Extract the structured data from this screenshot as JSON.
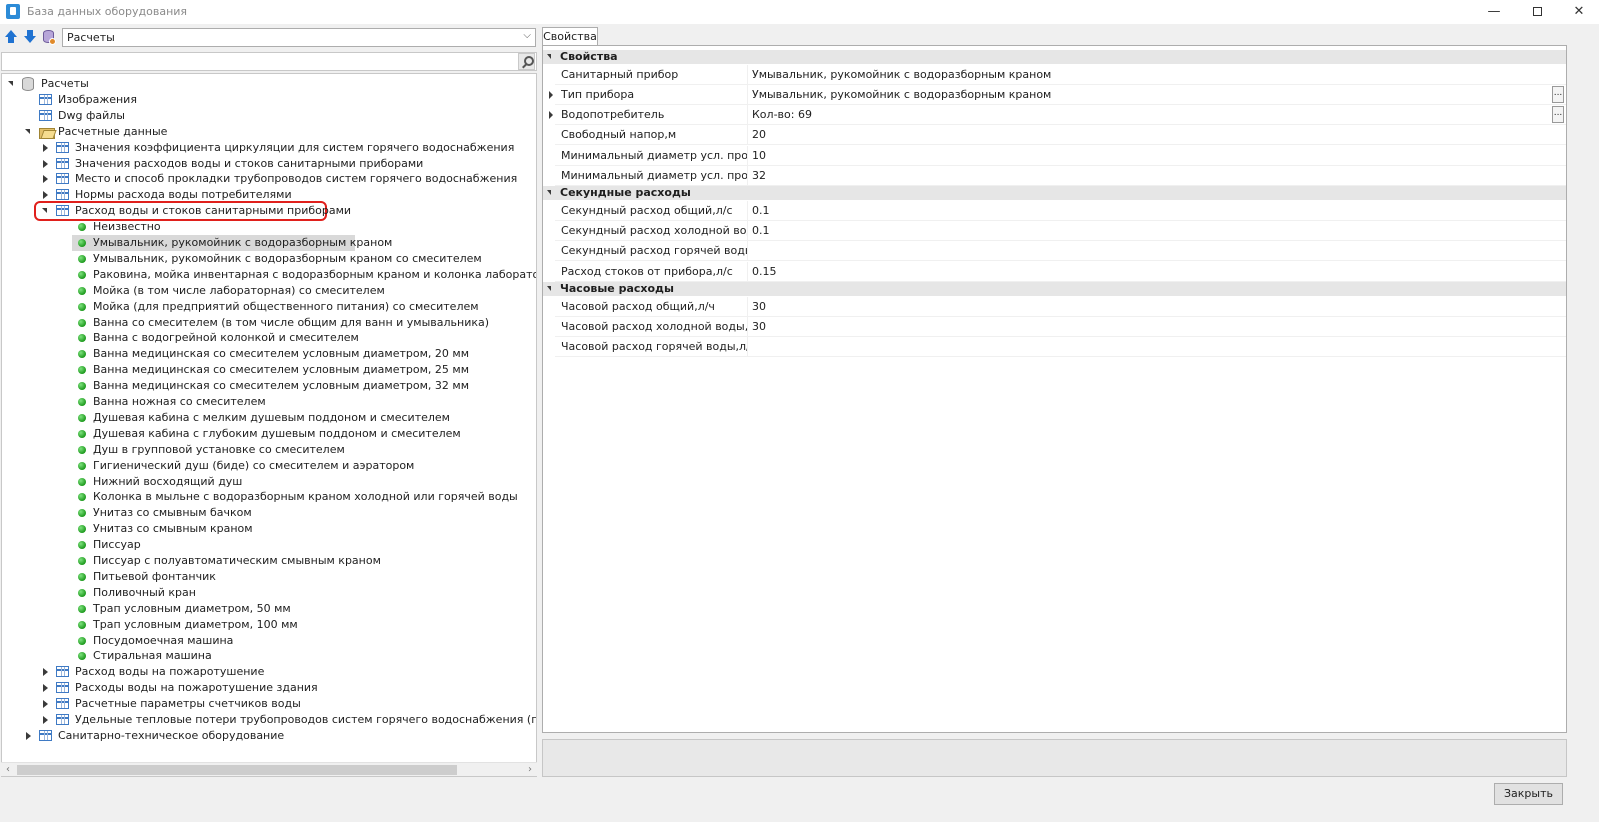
{
  "window": {
    "title": "База данных оборудования",
    "controls": {
      "minimize": "—",
      "maximize": "",
      "close": "✕"
    }
  },
  "toolbar": {
    "combo_value": "Расчеты",
    "icons": [
      "arrow-up-icon",
      "arrow-down-icon",
      "database-icon"
    ]
  },
  "tree": {
    "root": "Расчеты",
    "level1": [
      "Изображения",
      "Dwg файлы",
      "Расчетные данные"
    ],
    "calc_children": [
      "Значения коэффициента циркуляции для систем горячего водоснабжения",
      "Значения расходов воды и стоков санитарными приборами",
      "Место и способ прокладки трубопроводов систем горячего водоснабжения",
      "Нормы расхода воды потребителями",
      "Расход воды и стоков санитарными приборами"
    ],
    "devices": [
      "Неизвестно",
      "Умывальник, рукомойник с водоразборным краном",
      "Умывальник, рукомойник с водоразборным краном со смесителем",
      "Раковина, мойка инвентарная с водоразборным краном и колонка лабораторная водоразборная",
      "Мойка (в том числе лабораторная) со смесителем",
      "Мойка (для предприятий общественного питания) со смесителем",
      "Ванна со смесителем (в том числе общим для ванн и умывальника)",
      "Ванна с водогрейной колонкой и смесителем",
      "Ванна медицинская со смесителем условным диаметром, 20 мм",
      "Ванна медицинская со смесителем условным диаметром, 25 мм",
      "Ванна медицинская со смесителем условным диаметром, 32 мм",
      "Ванна ножная со смесителем",
      "Душевая кабина с мелким душевым поддоном и смесителем",
      "Душевая кабина с глубоким душевым поддоном и смесителем",
      "Душ в групповой установке со смесителем",
      "Гигиенический душ (биде) со смесителем и аэратором",
      "Нижний восходящий душ",
      "Колонка в мыльне с водоразборным краном холодной или горячей воды",
      "Унитаз со смывным бачком",
      "Унитаз со смывным краном",
      "Писсуар",
      "Писсуар с полуавтоматическим смывным краном",
      "Питьевой фонтанчик",
      "Поливочный кран",
      "Трап условным диаметром, 50 мм",
      "Трап условным диаметром, 100 мм",
      "Посудомоечная машина",
      "Стиральная машина"
    ],
    "calc_after": [
      "Расход воды на пожаротушение",
      "Расходы воды на пожаротушение здания",
      "Расчетные параметры счетчиков воды",
      "Удельные тепловые потери трубопроводов систем горячего водоснабжения (по месту и способу прокладки)"
    ],
    "sanitary": "Санитарно-техническое оборудование"
  },
  "properties": {
    "tab_label": "Свойства",
    "categories": [
      {
        "label": "Свойства",
        "rows": [
          {
            "name": "Санитарный прибор",
            "value": "Умывальник, рукомойник с водоразборным краном",
            "expandable": false,
            "button": false
          },
          {
            "name": "Тип прибора",
            "value": "Умывальник, рукомойник с водоразборным краном",
            "expandable": true,
            "button": true
          },
          {
            "name": "Водопотребитель",
            "value": "Кол-во: 69",
            "expandable": true,
            "button": true
          },
          {
            "name": "Свободный напор,м",
            "value": "20",
            "expandable": false,
            "button": false
          },
          {
            "name": "Минимальный диаметр усл. проход...",
            "value": "10",
            "expandable": false,
            "button": false
          },
          {
            "name": "Минимальный диаметр усл. проход...",
            "value": "32",
            "expandable": false,
            "button": false
          }
        ]
      },
      {
        "label": "Секундные расходы",
        "rows": [
          {
            "name": "Секундный расход общий,л/с",
            "value": "0.1",
            "expandable": false,
            "button": false
          },
          {
            "name": "Секундный расход холодной воды,л/с",
            "value": "0.1",
            "expandable": false,
            "button": false
          },
          {
            "name": "Секундный расход горячей воды,л/с",
            "value": "",
            "expandable": false,
            "button": false
          },
          {
            "name": "Расход стоков от прибора,л/с",
            "value": "0.15",
            "expandable": false,
            "button": false
          }
        ]
      },
      {
        "label": "Часовые расходы",
        "rows": [
          {
            "name": "Часовой расход общий,л/ч",
            "value": "30",
            "expandable": false,
            "button": false
          },
          {
            "name": "Часовой расход холодной воды,л/ч",
            "value": "30",
            "expandable": false,
            "button": false
          },
          {
            "name": "Часовой расход горячей воды,л/ч",
            "value": "",
            "expandable": false,
            "button": false
          }
        ]
      }
    ],
    "ellipsis": "..."
  },
  "footer": {
    "close_label": "Закрыть"
  },
  "colors": {
    "highlight": "#e0201c",
    "selected_row": "#d9d9d9",
    "category_bg": "#e6e6e6"
  }
}
